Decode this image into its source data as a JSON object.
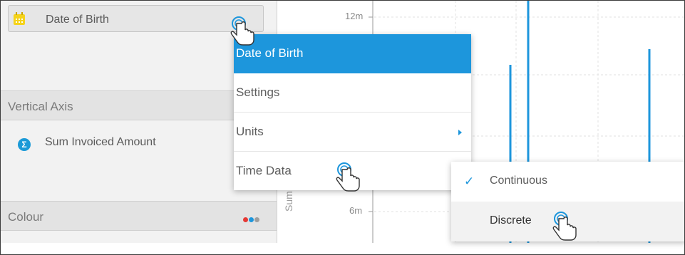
{
  "field_panel": {
    "x_field_label": "Date of Birth",
    "vertical_axis_title": "Vertical Axis",
    "measure_label": "Sum Invoiced Amount",
    "colour_title": "Colour",
    "colour_dots": [
      "#e53935",
      "#1d96dc",
      "#9e9e9e"
    ]
  },
  "chart": {
    "y_tick_top": "12m",
    "y_tick_mid": "6m",
    "y_axis_title": "Sum Invoic",
    "line_color": "#1d96dc"
  },
  "context_menu": {
    "items": [
      {
        "label": "Date of Birth",
        "active": true
      },
      {
        "label": "Settings"
      },
      {
        "label": "Units",
        "has_submenu": true
      },
      {
        "label": "Time Data"
      }
    ]
  },
  "time_data_submenu": {
    "checkmark": "✓",
    "items": [
      {
        "label": "Continuous",
        "checked": true
      },
      {
        "label": "Discrete",
        "hover": true
      }
    ]
  },
  "accent_color": "#1d96dc",
  "icons": [
    "calendar-icon",
    "sigma-icon",
    "chevron-right-icon",
    "check-icon",
    "hand-pointer-cursor"
  ]
}
